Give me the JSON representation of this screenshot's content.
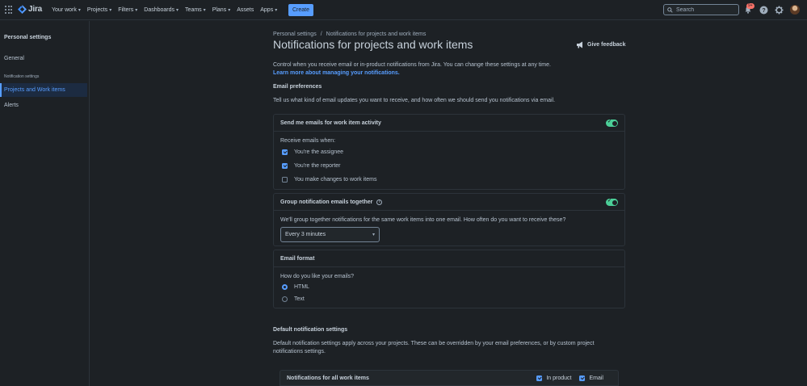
{
  "app": {
    "logo_text": "Jira",
    "brand_color": "#579dff"
  },
  "topnav": {
    "items": [
      {
        "label": "Your work",
        "dropdown": true
      },
      {
        "label": "Projects",
        "dropdown": true
      },
      {
        "label": "Filters",
        "dropdown": true
      },
      {
        "label": "Dashboards",
        "dropdown": true
      },
      {
        "label": "Teams",
        "dropdown": true
      },
      {
        "label": "Plans",
        "dropdown": true
      },
      {
        "label": "Assets",
        "dropdown": false
      },
      {
        "label": "Apps",
        "dropdown": true
      }
    ],
    "create_label": "Create",
    "search_placeholder": "Search",
    "notification_badge": "9+",
    "icons": [
      "apps-grid-icon",
      "bell-icon",
      "help-icon",
      "gear-icon",
      "avatar"
    ]
  },
  "sidebar": {
    "title": "Personal settings",
    "general_label": "General",
    "heading": "Notification settings",
    "items": [
      {
        "label": "Projects and Work items",
        "active": true
      },
      {
        "label": "Alerts",
        "active": false
      }
    ]
  },
  "breadcrumb": {
    "root": "Personal settings",
    "separator": "/",
    "current": "Notifications for projects and work items"
  },
  "page": {
    "title": "Notifications for projects and work items",
    "feedback_label": "Give feedback",
    "intro": "Control when you receive email or in-product notifications from Jira. You can change these settings at any time.",
    "learn_more": "Learn more about managing your notifications."
  },
  "email_preferences": {
    "heading": "Email preferences",
    "description": "Tell us what kind of email updates you want to receive, and how often we should send you notifications via email."
  },
  "send_emails_card": {
    "title": "Send me emails for work item activity",
    "toggle_on": true,
    "receive_label": "Receive emails when:",
    "options": [
      {
        "label": "You're the assignee",
        "checked": true
      },
      {
        "label": "You're the reporter",
        "checked": true
      },
      {
        "label": "You make changes to work items",
        "checked": false
      }
    ]
  },
  "group_card": {
    "title": "Group notification emails together",
    "toggle_on": true,
    "question": "We'll group together notifications for the same work items into one email. How often do you want to receive these?",
    "selected": "Every 3 minutes"
  },
  "format_card": {
    "title": "Email format",
    "question": "How do you like your emails?",
    "options": [
      {
        "label": "HTML",
        "selected": true
      },
      {
        "label": "Text",
        "selected": false
      }
    ]
  },
  "default_settings": {
    "heading": "Default notification settings",
    "description": "Default notification settings apply across your projects. These can be overridden by your email preferences, or by custom project notifications settings."
  },
  "all_items_row": {
    "title": "Notifications for all work items",
    "in_product_label": "In product",
    "in_product_checked": true,
    "email_label": "Email",
    "email_checked": true
  }
}
